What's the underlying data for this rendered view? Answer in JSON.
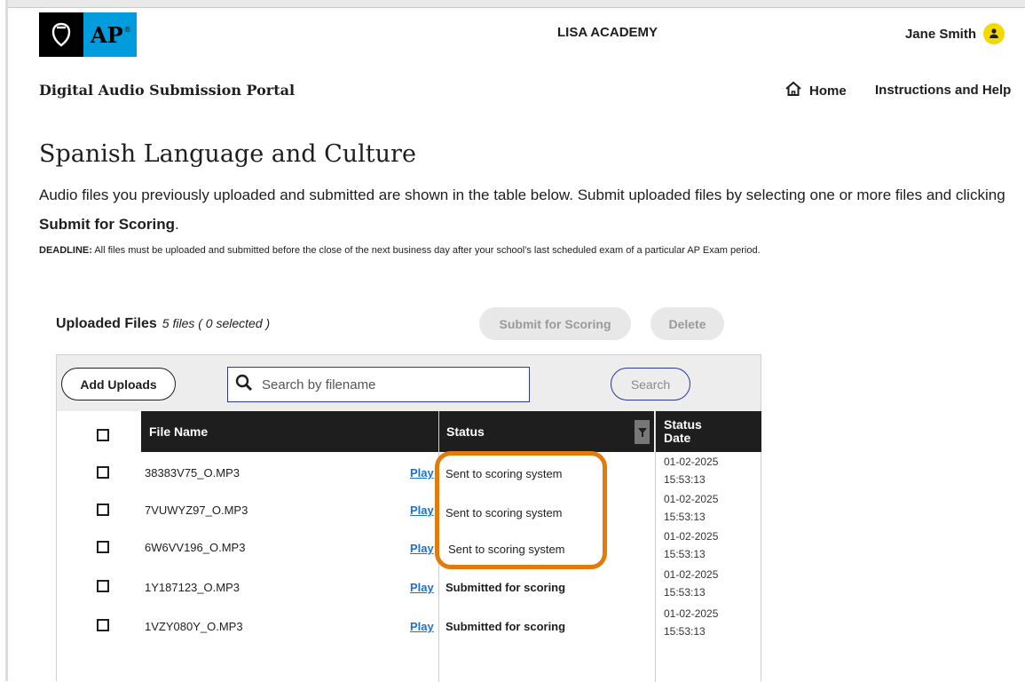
{
  "header": {
    "logo_text": "AP",
    "school": "LISA ACADEMY",
    "user_name": "Jane Smith",
    "portal_title": "Digital Audio Submission Portal",
    "nav_home": "Home",
    "nav_help": "Instructions and Help"
  },
  "page": {
    "title": "Spanish Language and Culture",
    "intro_text": "Audio files you previously uploaded and submitted are shown in the table below. Submit uploaded files by selecting one or more files and clicking ",
    "intro_bold": "Submit for Scoring",
    "intro_end": ".",
    "deadline_label": "DEADLINE:",
    "deadline_text": " All files must be uploaded and submitted before the close of the next business day after your school's last scheduled exam of a particular AP Exam period."
  },
  "files": {
    "heading": "Uploaded Files",
    "count": "5 files ( 0 selected )",
    "submit_label": "Submit for Scoring",
    "delete_label": "Delete",
    "add_label": "Add Uploads",
    "search_placeholder": "Search by filename",
    "search_label": "Search",
    "columns": [
      "File Name",
      "Status",
      "Status Date"
    ],
    "rows": [
      {
        "name": "38383V75_O.MP3",
        "play": "Play",
        "status": "Sent to scoring system",
        "date": "01-02-2025",
        "time": "15:53:13"
      },
      {
        "name": "7VUWYZ97_O.MP3",
        "play": "Play",
        "status": "Sent to scoring system",
        "date": "01-02-2025",
        "time": "15:53:13"
      },
      {
        "name": "6W6VV196_O.MP3",
        "play": "Play",
        "status": "Sent to scoring system",
        "date": "01-02-2025",
        "time": "15:53:13"
      },
      {
        "name": "1Y187123_O.MP3",
        "play": "Play",
        "status": "Submitted for scoring",
        "date": "01-02-2025",
        "time": "15:53:13"
      },
      {
        "name": "1VZY080Y_O.MP3",
        "play": "Play",
        "status": "Submitted for scoring",
        "date": "01-02-2025",
        "time": "15:53:13"
      }
    ]
  },
  "colors": {
    "brand_blue": "#009cde",
    "avatar_yellow": "#f5d800",
    "highlight_orange": "#e07b0c",
    "link_blue": "#1a73c9"
  }
}
